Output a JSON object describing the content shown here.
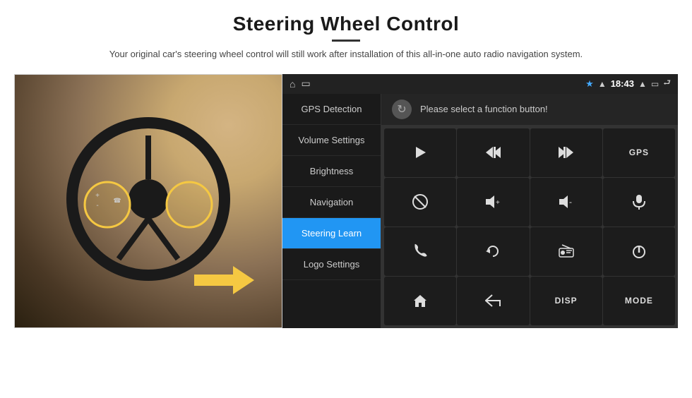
{
  "page": {
    "title": "Steering Wheel Control",
    "divider": true,
    "subtitle": "Your original car's steering wheel control will still work after installation of this all-in-one auto radio navigation system."
  },
  "status_bar": {
    "left_icons": [
      "home",
      "cast"
    ],
    "bluetooth": "BT",
    "wifi": "wifi",
    "time": "18:43",
    "expand": "^",
    "battery": "▭",
    "back": "↩"
  },
  "menu": {
    "items": [
      {
        "id": "gps",
        "label": "GPS Detection",
        "active": false
      },
      {
        "id": "volume",
        "label": "Volume Settings",
        "active": false
      },
      {
        "id": "brightness",
        "label": "Brightness",
        "active": false
      },
      {
        "id": "navigation",
        "label": "Navigation",
        "active": false
      },
      {
        "id": "steering",
        "label": "Steering Learn",
        "active": true
      },
      {
        "id": "logo",
        "label": "Logo Settings",
        "active": false
      }
    ]
  },
  "function_area": {
    "header_prompt": "Please select a function button!",
    "buttons": [
      {
        "id": "play",
        "icon": "▶",
        "label": "play",
        "type": "icon"
      },
      {
        "id": "prev",
        "icon": "⏮",
        "label": "previous",
        "type": "icon"
      },
      {
        "id": "next",
        "icon": "⏭",
        "label": "next",
        "type": "icon"
      },
      {
        "id": "gps",
        "icon": "GPS",
        "label": "GPS",
        "type": "text"
      },
      {
        "id": "mute",
        "icon": "⊘",
        "label": "mute",
        "type": "icon"
      },
      {
        "id": "vol-up",
        "icon": "🔊+",
        "label": "volume up",
        "type": "icon"
      },
      {
        "id": "vol-down",
        "icon": "🔊-",
        "label": "volume down",
        "type": "icon"
      },
      {
        "id": "mic",
        "icon": "🎤",
        "label": "microphone",
        "type": "icon"
      },
      {
        "id": "phone",
        "icon": "📞",
        "label": "phone",
        "type": "icon"
      },
      {
        "id": "rotate",
        "icon": "↺",
        "label": "rotate",
        "type": "icon"
      },
      {
        "id": "radio",
        "icon": "📻",
        "label": "radio",
        "type": "icon"
      },
      {
        "id": "power",
        "icon": "⏻",
        "label": "power",
        "type": "icon"
      },
      {
        "id": "home",
        "icon": "⌂",
        "label": "home",
        "type": "icon"
      },
      {
        "id": "back2",
        "icon": "↩",
        "label": "back",
        "type": "icon"
      },
      {
        "id": "disp",
        "icon": "DISP",
        "label": "DISP",
        "type": "text"
      },
      {
        "id": "mode",
        "icon": "MODE",
        "label": "MODE",
        "type": "text"
      }
    ]
  }
}
